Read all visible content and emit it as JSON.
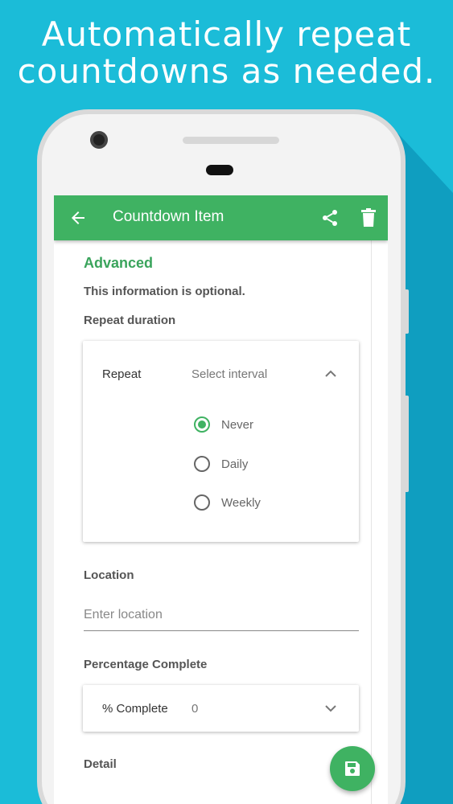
{
  "promo": {
    "headline_line1": "Automatically repeat",
    "headline_line2": "countdowns as needed."
  },
  "colors": {
    "background": "#1bbcd8",
    "accent": "#3fb262",
    "section_title": "#3aa45c"
  },
  "appbar": {
    "title": "Countdown Item",
    "back_icon": "arrow-left-icon",
    "share_icon": "share-icon",
    "delete_icon": "trash-icon"
  },
  "form": {
    "section_title": "Advanced",
    "optional_note": "This information is optional.",
    "repeat_duration": {
      "label": "Repeat duration",
      "field_label": "Repeat",
      "value": "Select interval",
      "options": [
        {
          "label": "Never",
          "selected": true
        },
        {
          "label": "Daily",
          "selected": false
        },
        {
          "label": "Weekly",
          "selected": false
        }
      ]
    },
    "location": {
      "label": "Location",
      "placeholder": "Enter location",
      "value": ""
    },
    "percentage": {
      "label": "Percentage Complete",
      "field_label": "% Complete",
      "value": "0"
    },
    "detail": {
      "label": "Detail"
    }
  },
  "fab": {
    "icon": "save-icon"
  }
}
